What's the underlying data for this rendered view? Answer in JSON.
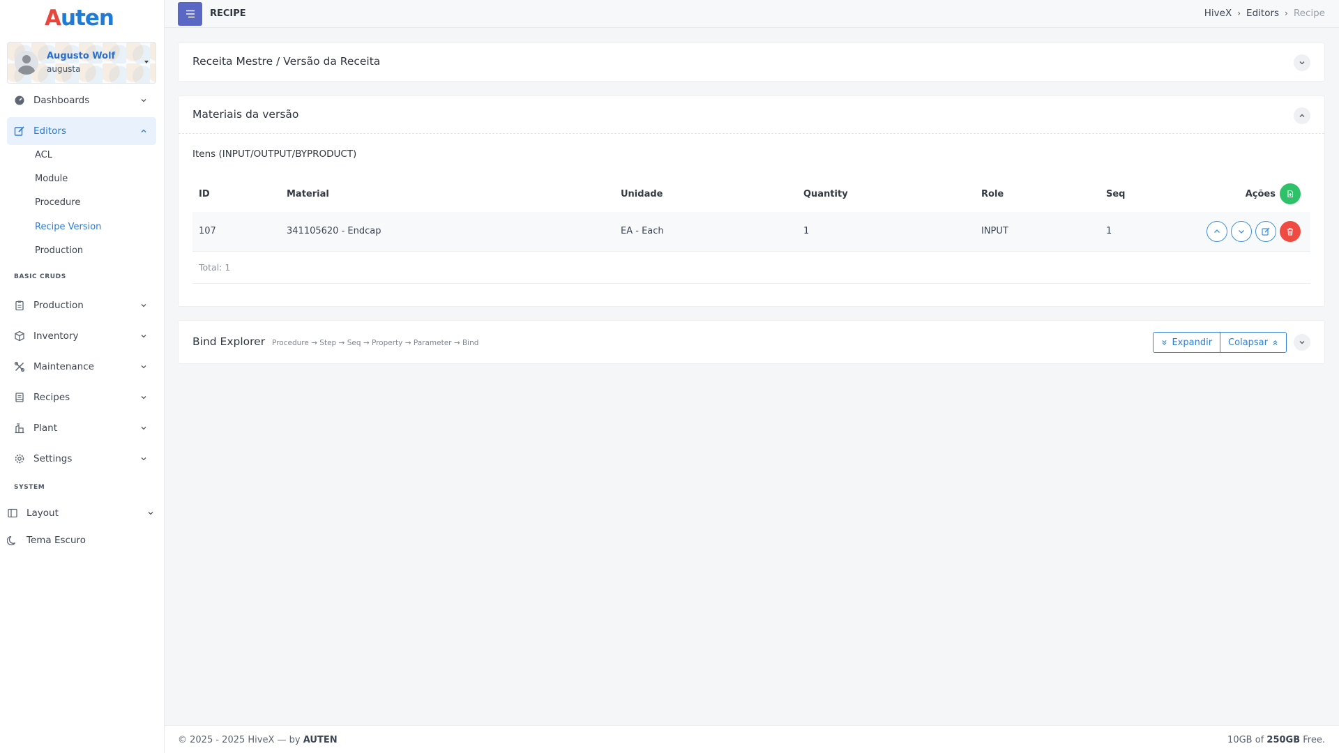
{
  "brand": {
    "logo_first": "A",
    "logo_rest": "uten"
  },
  "user": {
    "name": "Augusto Wolf",
    "login": "augusta"
  },
  "sidebar": {
    "items": [
      {
        "label": "Dashboards",
        "icon": "dashboard-icon"
      },
      {
        "label": "Editors",
        "icon": "edit-icon",
        "active": true
      },
      {
        "label": "Production",
        "icon": "clipboard-icon"
      },
      {
        "label": "Inventory",
        "icon": "box-icon"
      },
      {
        "label": "Maintenance",
        "icon": "tools-icon"
      },
      {
        "label": "Recipes",
        "icon": "book-icon"
      },
      {
        "label": "Plant",
        "icon": "factory-icon"
      },
      {
        "label": "Settings",
        "icon": "gear-icon"
      }
    ],
    "editors_sub": [
      "ACL",
      "Module",
      "Procedure",
      "Recipe Version",
      "Production"
    ],
    "section_basic": "BASIC CRUDS",
    "section_system": "SYSTEM",
    "layout_label": "Layout",
    "dark_theme_label": "Tema Escuro"
  },
  "topbar": {
    "page": "RECIPE",
    "breadcrumb": [
      "HiveX",
      "Editors",
      "Recipe"
    ]
  },
  "card_master": {
    "title": "Receita Mestre / Versão da Receita"
  },
  "card_materials": {
    "title": "Materiais da versão",
    "subtitle": "Itens (INPUT/OUTPUT/BYPRODUCT)",
    "columns": [
      "ID",
      "Material",
      "Unidade",
      "Quantity",
      "Role",
      "Seq",
      "Ações"
    ],
    "rows": [
      {
        "id": "107",
        "material": "341105620 - Endcap",
        "unit": "EA - Each",
        "quantity": "1",
        "role": "INPUT",
        "seq": "1"
      }
    ],
    "total": "Total: 1"
  },
  "card_bind": {
    "title": "Bind Explorer",
    "path": "Procedure → Step → Seq → Property → Parameter → Bind",
    "expand_label": "Expandir",
    "collapse_label": "Colapsar"
  },
  "footer": {
    "left_prefix": "© 2025 - 2025 HiveX — by",
    "left_brand": "AUTEN",
    "right_used": "10GB",
    "right_of": "of",
    "right_total": "250GB",
    "right_suffix": "Free."
  },
  "colors": {
    "accent": "#2a7bd8",
    "menu_button": "#5a67c4",
    "add": "#2ec16a",
    "delete": "#ef4b42"
  }
}
